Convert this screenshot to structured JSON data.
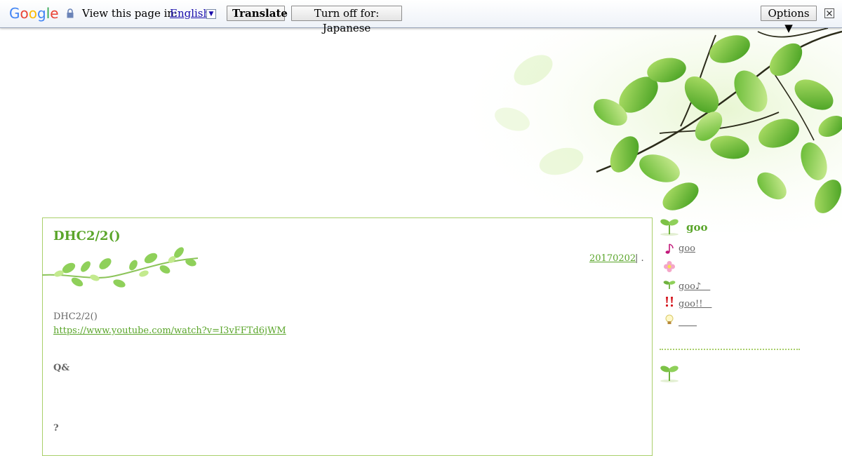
{
  "translate_bar": {
    "logo": "Google",
    "view_label": "View this page in:",
    "language": "English",
    "translate_label": "Translate",
    "turn_off_label": "Turn off for: Japanese",
    "options_label": "Options ▼"
  },
  "post": {
    "title": "DHC2/2()",
    "date": "20170202",
    "meta": "| .",
    "body_line1": "DHC2/2()",
    "link": "https://www.youtube.com/watch?v=I3vFFTd6jWM",
    "heading_qa": "Q&",
    "heading_q": "?"
  },
  "sidebar": {
    "title": "goo",
    "items": [
      {
        "icon": "music-note-icon",
        "label": "goo"
      },
      {
        "icon": "flower-icon",
        "label": ""
      },
      {
        "icon": "sprout-icon",
        "label": "goo♪　"
      },
      {
        "icon": "exclamation-icon",
        "label": "goo!!　"
      },
      {
        "icon": "lightbulb-icon",
        "label": "　　"
      }
    ]
  },
  "colors": {
    "accent_green": "#5aa52a",
    "border_green": "#a9cf6a",
    "link_blue": "#1a0dab"
  }
}
